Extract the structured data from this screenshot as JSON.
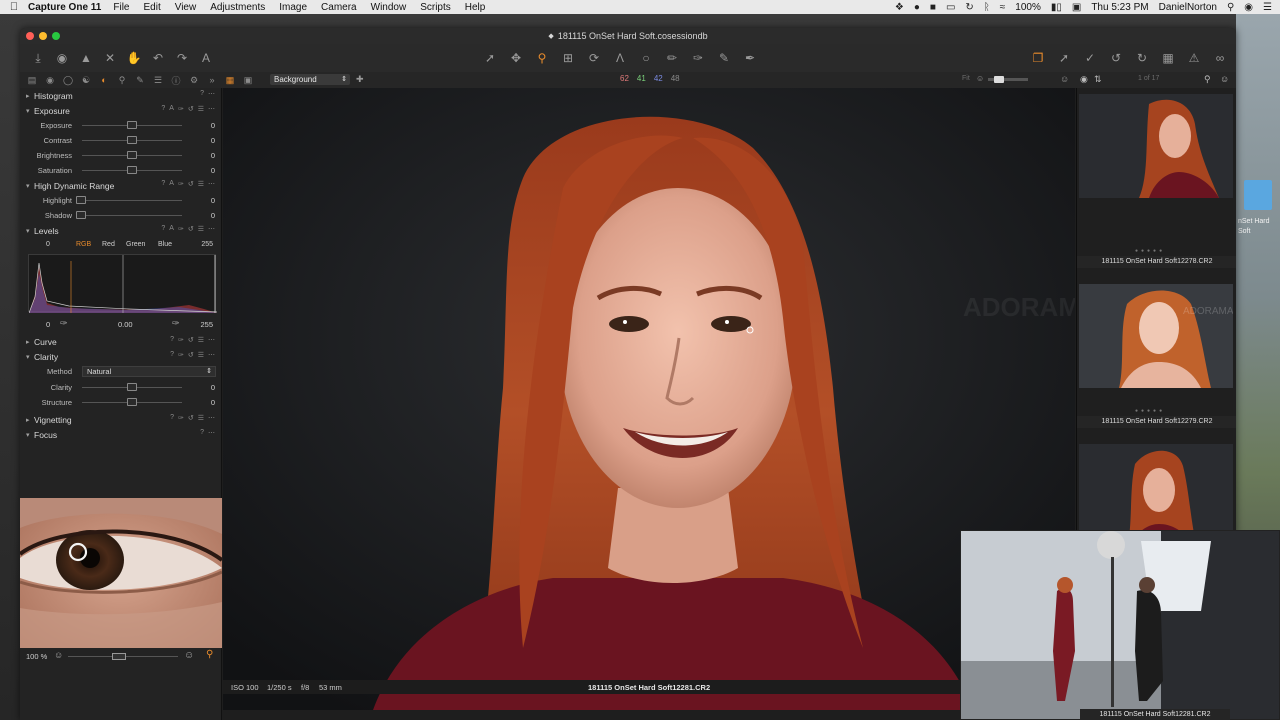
{
  "menubar": {
    "app_name": "Capture One 11",
    "menus": [
      "File",
      "Edit",
      "View",
      "Adjustments",
      "Image",
      "Camera",
      "Window",
      "Scripts",
      "Help"
    ],
    "battery": "100%",
    "datetime": "Thu 5:23 PM",
    "user": "DanielNorton"
  },
  "window": {
    "title": "181115 OnSet Hard Soft.cosessiondb"
  },
  "tabsbar": {
    "layer": "Background",
    "rgb": {
      "r": "62",
      "g": "41",
      "b": "42",
      "l": "48"
    },
    "counter": "1 of 17"
  },
  "panel": {
    "histogram": {
      "title": "Histogram"
    },
    "exposure": {
      "title": "Exposure",
      "rows": [
        {
          "label": "Exposure",
          "value": "0",
          "pos": 0.5
        },
        {
          "label": "Contrast",
          "value": "0",
          "pos": 0.5
        },
        {
          "label": "Brightness",
          "value": "0",
          "pos": 0.5
        },
        {
          "label": "Saturation",
          "value": "0",
          "pos": 0.5
        }
      ]
    },
    "hdr": {
      "title": "High Dynamic Range",
      "rows": [
        {
          "label": "Highlight",
          "value": "0",
          "pos": 0
        },
        {
          "label": "Shadow",
          "value": "0",
          "pos": 0
        }
      ]
    },
    "levels": {
      "title": "Levels",
      "low": "0",
      "high": "255",
      "channels": [
        "RGB",
        "Red",
        "Green",
        "Blue"
      ],
      "active_channel": "RGB",
      "foot_low": "0",
      "foot_mid": "0.00",
      "foot_high": "255"
    },
    "curve": {
      "title": "Curve"
    },
    "clarity": {
      "title": "Clarity",
      "method_label": "Method",
      "method_value": "Natural",
      "rows": [
        {
          "label": "Clarity",
          "value": "0",
          "pos": 0.5
        },
        {
          "label": "Structure",
          "value": "0",
          "pos": 0.5
        }
      ]
    },
    "vignetting": {
      "title": "Vignetting"
    },
    "focus": {
      "title": "Focus",
      "zoom": "100 %"
    }
  },
  "viewer": {
    "iso": "ISO 100",
    "shutter": "1/250 s",
    "aperture": "f/8",
    "focal": "53 mm",
    "filename": "181115 OnSet Hard Soft12281.CR2"
  },
  "browser": {
    "items": [
      {
        "filename": "181115 OnSet Hard Soft12278.CR2"
      },
      {
        "filename": "181115 OnSet Hard Soft12279.CR2"
      },
      {
        "filename": "181115 OnSet Hard Soft12281.CR2"
      }
    ]
  },
  "desktop": {
    "label_line1": "nSet Hard",
    "label_line2": "Soft"
  },
  "colors": {
    "accent": "#e88b2c",
    "r": "#e07a7a",
    "g": "#7ad07a",
    "b": "#7a8ae0"
  }
}
